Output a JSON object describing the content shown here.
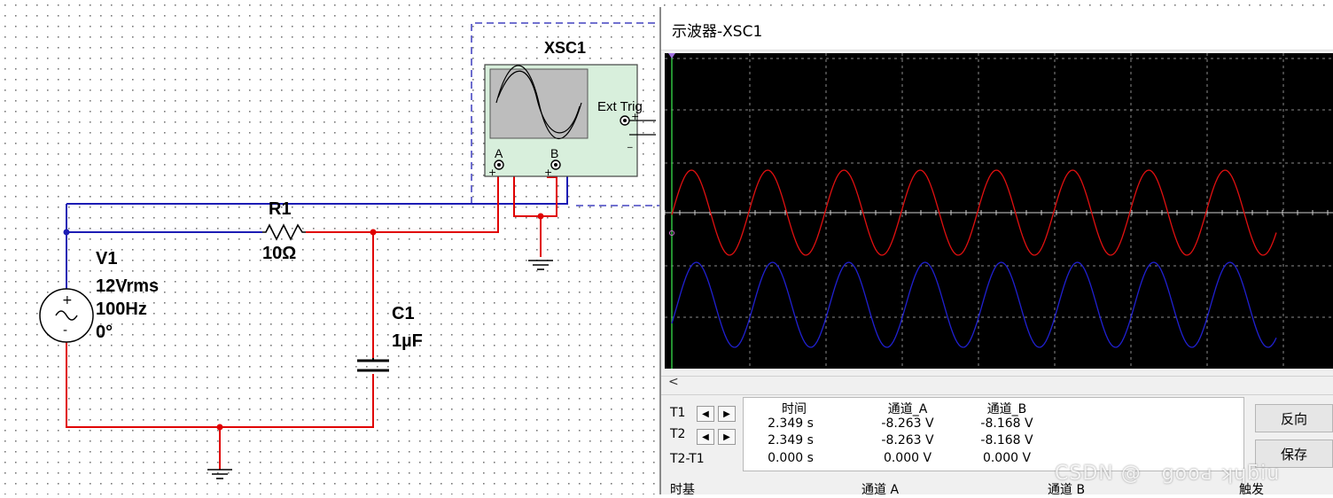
{
  "circuit": {
    "source": {
      "name": "V1",
      "voltage": "12Vrms",
      "frequency": "100Hz",
      "phase": "0°"
    },
    "resistor": {
      "name": "R1",
      "value": "10Ω"
    },
    "capacitor": {
      "name": "C1",
      "value": "1µF"
    },
    "scope_instrument": {
      "name": "XSC1",
      "ext_trig": "Ext Trig",
      "channel_a": "A",
      "channel_b": "B",
      "plus": "+",
      "minus": "_"
    }
  },
  "scope_window": {
    "title": "示波器-XSC1",
    "scroll_arrow": "<",
    "cursors": {
      "t1": "T1",
      "t2": "T2",
      "t2_t1": "T2-T1"
    },
    "headers": {
      "time": "时间",
      "ch_a": "通道_A",
      "ch_b": "通道_B"
    },
    "rows": [
      {
        "time": "2.349 s",
        "a": "-8.263 V",
        "b": "-8.168 V"
      },
      {
        "time": "2.349 s",
        "a": "-8.263 V",
        "b": "-8.168 V"
      },
      {
        "time": "0.000 s",
        "a": "0.000 V",
        "b": "0.000 V"
      }
    ],
    "buttons": {
      "reverse": "反向",
      "save": "保存"
    },
    "bottom": {
      "timebase": "时基",
      "ch_a": "通道 A",
      "ch_b": "通道 B",
      "trigger": "触发"
    }
  },
  "watermark": "CSDN @　gооԁ ʞɥƃiu",
  "colors": {
    "wire_red": "#e00000",
    "wire_blue": "#1c1cb4",
    "trace_a": "#e01010",
    "trace_b": "#2020d0"
  }
}
